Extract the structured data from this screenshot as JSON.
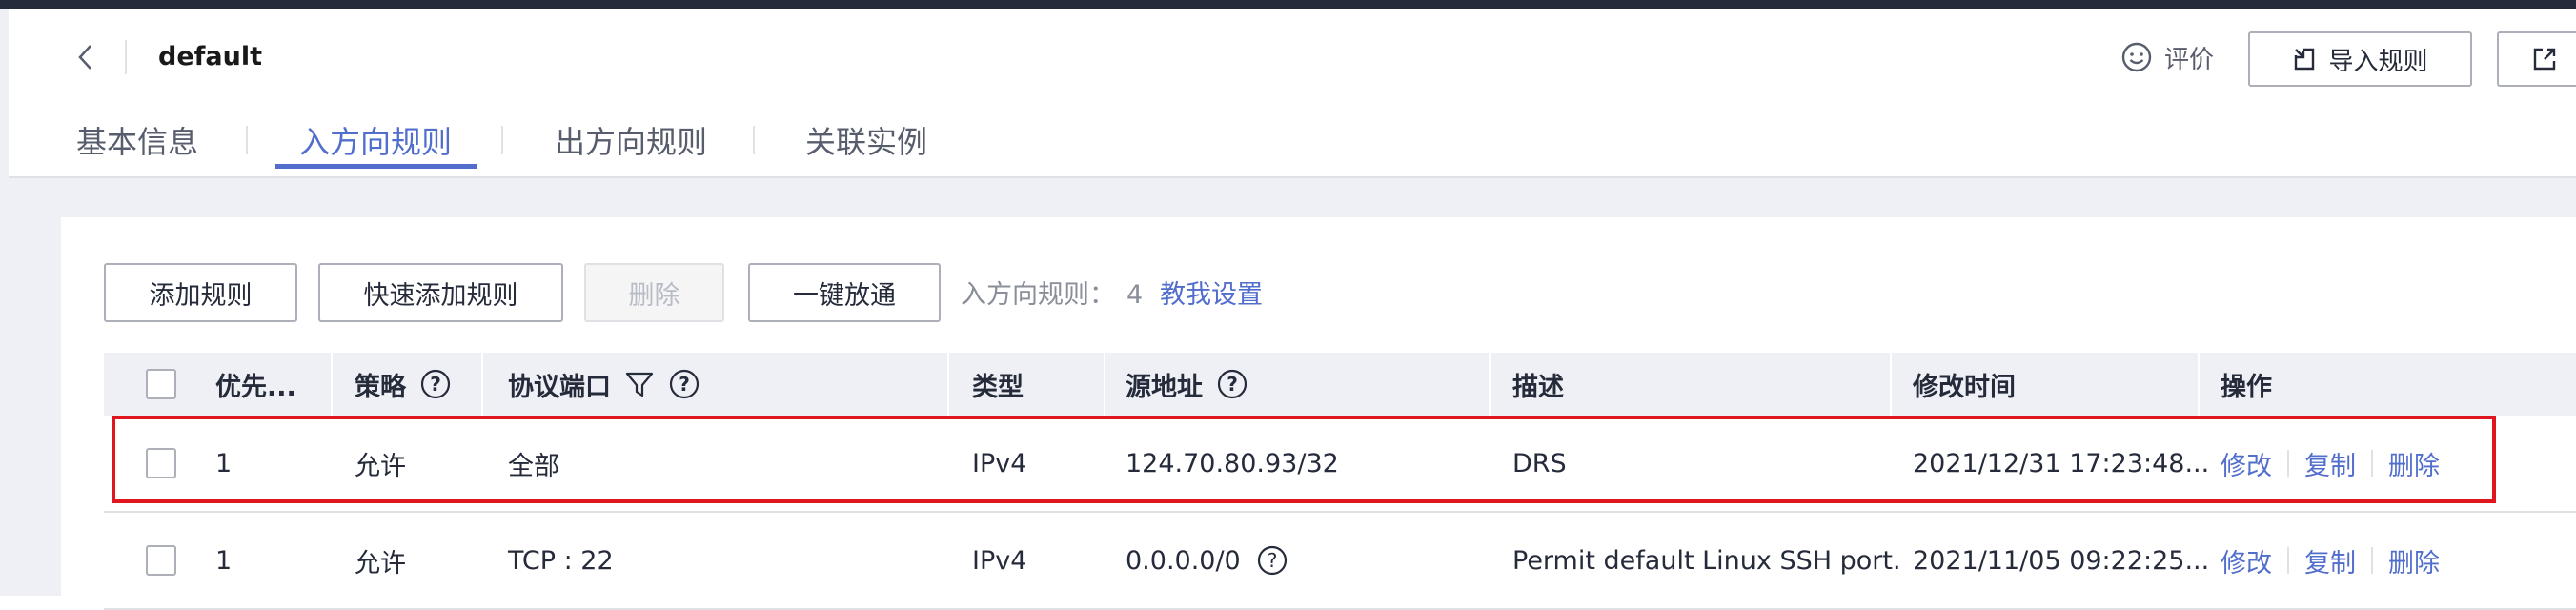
{
  "header": {
    "title": "default",
    "feedback_label": "评价",
    "import_label": "导入规则"
  },
  "tabs": [
    {
      "label": "基本信息",
      "active": false
    },
    {
      "label": "入方向规则",
      "active": true
    },
    {
      "label": "出方向规则",
      "active": false
    },
    {
      "label": "关联实例",
      "active": false
    }
  ],
  "toolbar": {
    "add_rule": "添加规则",
    "quick_add_rule": "快速添加规则",
    "delete": "删除",
    "one_click_allow": "一键放通",
    "rule_count_label": "入方向规则：",
    "rule_count": "4",
    "help_link": "教我设置"
  },
  "table": {
    "columns": {
      "priority": "优先...",
      "policy": "策略",
      "protocol_port": "协议端口",
      "type": "类型",
      "source": "源地址",
      "description": "描述",
      "modified": "修改时间",
      "actions": "操作"
    },
    "rows": [
      {
        "priority": "1",
        "policy": "允许",
        "protocol_port": "全部",
        "type": "IPv4",
        "source": "124.70.80.93/32",
        "description": "DRS",
        "modified": "2021/12/31 17:23:48...",
        "highlighted": true
      },
      {
        "priority": "1",
        "policy": "允许",
        "protocol_port": "TCP : 22",
        "type": "IPv4",
        "source": "0.0.0.0/0",
        "description": "Permit default Linux SSH port.",
        "modified": "2021/11/05 09:22:25...",
        "highlighted": false
      }
    ],
    "actions": {
      "modify": "修改",
      "copy": "复制",
      "delete": "删除"
    }
  },
  "colors": {
    "accent": "#526ecc",
    "highlight_border": "#e0161f",
    "header_bg": "#eef0f5"
  }
}
